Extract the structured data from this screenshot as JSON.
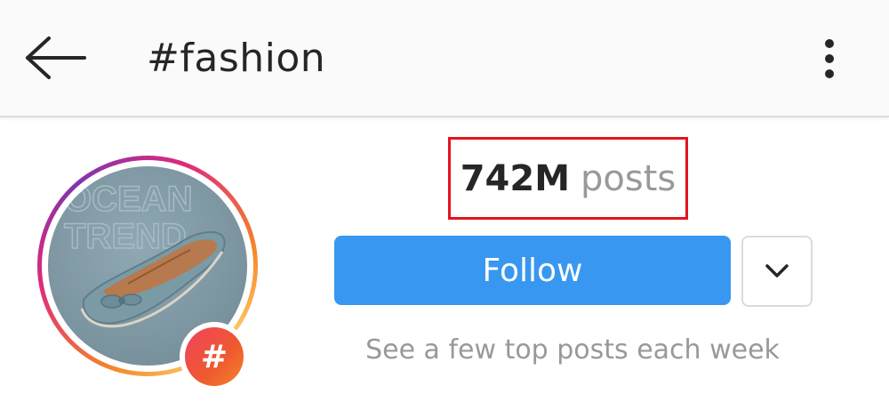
{
  "header": {
    "title": "#fashion",
    "back_icon": "arrow-left-icon",
    "more_icon": "more-vertical-icon"
  },
  "profile": {
    "badge_symbol": "#",
    "image_overlay_text": [
      "OCEAN",
      "TREND"
    ],
    "image_subject": "shoe"
  },
  "stats": {
    "posts_count": "742M",
    "posts_label": "posts"
  },
  "actions": {
    "follow_label": "Follow",
    "dropdown_icon": "chevron-down-icon",
    "hint": "See a few top posts each week"
  },
  "colors": {
    "follow_button": "#3897f0",
    "highlight_box": "#e3141f",
    "badge": "#f0405f"
  }
}
